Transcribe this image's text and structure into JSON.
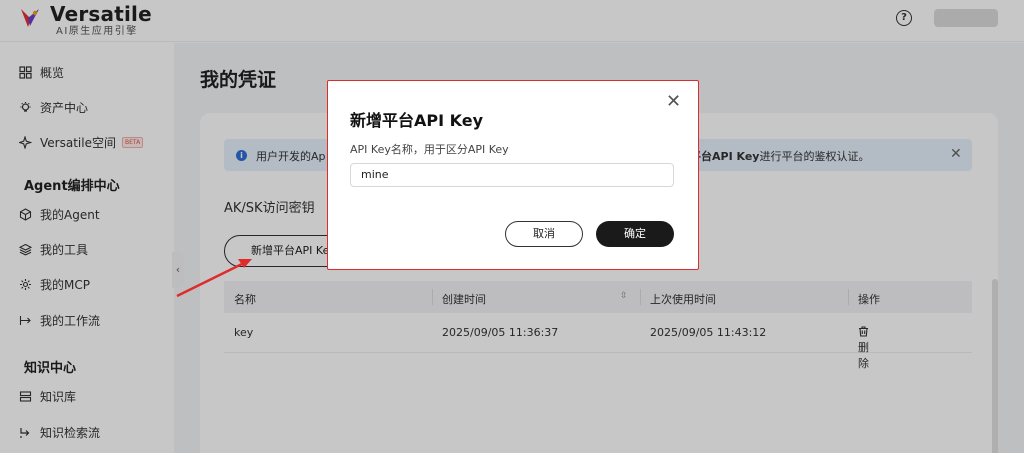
{
  "brand": {
    "title": "Versatile",
    "subtitle": "AI原生应用引擎"
  },
  "header": {
    "help_icon": "?"
  },
  "sidebar": {
    "items": [
      {
        "label": "概览",
        "icon": "grid-icon"
      },
      {
        "label": "资产中心",
        "icon": "bulb-icon"
      },
      {
        "label": "Versatile空间",
        "icon": "sparkle-icon",
        "badge": "BETA"
      }
    ],
    "agent_section": "Agent编排中心",
    "agent_items": [
      {
        "label": "我的Agent",
        "icon": "cube-icon"
      },
      {
        "label": "我的工具",
        "icon": "layers-icon"
      },
      {
        "label": "我的MCP",
        "icon": "mcp-icon"
      },
      {
        "label": "我的工作流",
        "icon": "flow-icon"
      }
    ],
    "knowledge_section": "知识中心",
    "knowledge_items": [
      {
        "label": "知识库",
        "icon": "database-icon"
      },
      {
        "label": "知识检索流",
        "icon": "retrieval-icon"
      }
    ],
    "collapse_glyph": "‹"
  },
  "main": {
    "title": "我的凭证",
    "info": {
      "left_text": "用户开发的Ap",
      "right_bold": "平台API Key",
      "right_text": "进行平台的鉴权认证。",
      "close": "✕"
    },
    "section_title": "AK/SK访问密钥",
    "add_button": "新增平台API Key",
    "table": {
      "columns": [
        "名称",
        "创建时间",
        "上次使用时间",
        "操作"
      ],
      "rows": [
        {
          "name": "key",
          "created": "2025/09/05 11:36:37",
          "last_used": "2025/09/05 11:43:12",
          "action": "删除"
        }
      ]
    }
  },
  "modal": {
    "title": "新增平台API Key",
    "close": "✕",
    "field_label": "API Key名称，用于区分API Key",
    "field_value": "mine",
    "cancel": "取消",
    "confirm": "确定"
  },
  "colors": {
    "accent_red": "#e02b2b",
    "primary_btn": "#1a1a1a",
    "info_bg": "#e6f0fb"
  }
}
